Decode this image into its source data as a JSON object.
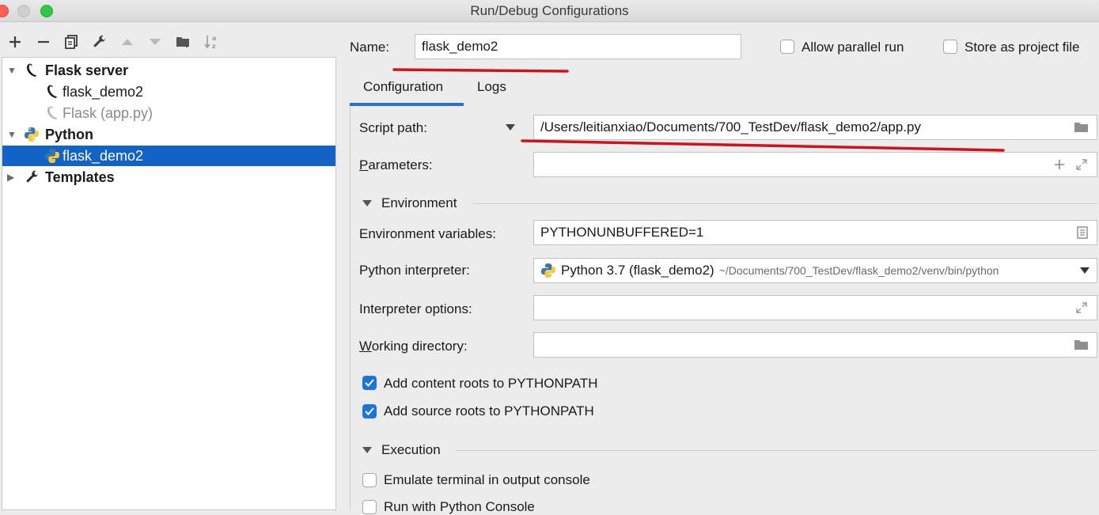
{
  "window": {
    "title": "Run/Debug Configurations"
  },
  "toolbar": {
    "add_icon": "plus-icon",
    "remove_icon": "minus-icon",
    "copy_icon": "copy-icon",
    "edit_defaults_icon": "wrench-icon",
    "move_up_icon": "arrow-up-icon",
    "move_down_icon": "arrow-down-icon",
    "folder_icon": "new-folder-icon",
    "sort_icon": "sort-alpha-icon"
  },
  "tree": {
    "flask_server": {
      "label": "Flask server"
    },
    "flask_demo2_flask": {
      "label": "flask_demo2"
    },
    "flask_app": {
      "label": "Flask (app.py)"
    },
    "python": {
      "label": "Python"
    },
    "flask_demo2_python": {
      "label": "flask_demo2"
    },
    "templates": {
      "label": "Templates"
    }
  },
  "header": {
    "name_label": "Name:",
    "name_value": "flask_demo2",
    "allow_parallel_label": "Allow parallel run",
    "allow_parallel_checked": false,
    "store_project_label": "Store as project file",
    "store_project_checked": false
  },
  "tabs": {
    "configuration": "Configuration",
    "logs": "Logs",
    "active": "configuration"
  },
  "config": {
    "script_path_label": "Script path:",
    "script_path_value": "/Users/leitianxiao/Documents/700_TestDev/flask_demo2/app.py",
    "parameters_label": "Parameters:",
    "parameters_value": "",
    "environment_section": "Environment",
    "env_vars_label": "Environment variables:",
    "env_vars_value": "PYTHONUNBUFFERED=1",
    "interpreter_label": "Python interpreter:",
    "interpreter_name": "Python 3.7 (flask_demo2)",
    "interpreter_path": "~/Documents/700_TestDev/flask_demo2/venv/bin/python",
    "interpreter_options_label": "Interpreter options:",
    "interpreter_options_value": "",
    "working_dir_label": "Working directory:",
    "working_dir_value": "",
    "add_content_roots_label": "Add content roots to PYTHONPATH",
    "add_content_roots_checked": true,
    "add_source_roots_label": "Add source roots to PYTHONPATH",
    "add_source_roots_checked": true,
    "execution_section": "Execution",
    "emulate_terminal_label": "Emulate terminal in output console",
    "emulate_terminal_checked": false,
    "run_python_console_label": "Run with Python Console",
    "run_python_console_checked": false
  },
  "colors": {
    "selection": "#1362c5",
    "accent": "#1e75d9",
    "annotation": "#d0121b"
  }
}
